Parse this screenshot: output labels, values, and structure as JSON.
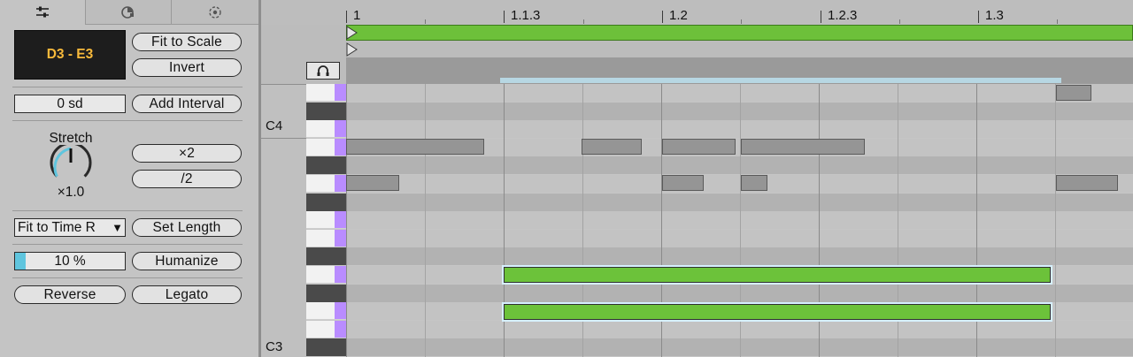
{
  "tabs": [
    {
      "name": "sliders-icon",
      "active": true
    },
    {
      "name": "shape-icon",
      "active": false
    },
    {
      "name": "target-icon",
      "active": false
    }
  ],
  "range_display": "D3 - E3",
  "buttons": {
    "fit_to_scale": "Fit to Scale",
    "invert": "Invert",
    "add_interval": "Add Interval",
    "times_two": "×2",
    "half": "/2",
    "set_length": "Set Length",
    "humanize": "Humanize",
    "reverse": "Reverse",
    "legato": "Legato"
  },
  "interval_field": "0 sd",
  "stretch": {
    "label": "Stretch",
    "value": "×1.0"
  },
  "fit_select": {
    "value": "Fit to Time R"
  },
  "humanize_amount": {
    "text": "10 %",
    "fraction": 0.1
  },
  "ruler": {
    "labels": [
      "1",
      "1.1.3",
      "1.2",
      "1.2.3",
      "1.3"
    ]
  },
  "pitch_labels": [
    "C4",
    "C3"
  ],
  "colors": {
    "accent_green": "#6cc23a",
    "range_text": "#f7b93b",
    "lane_purple": "#b98cff",
    "humanize_fill": "#5fc5de"
  }
}
